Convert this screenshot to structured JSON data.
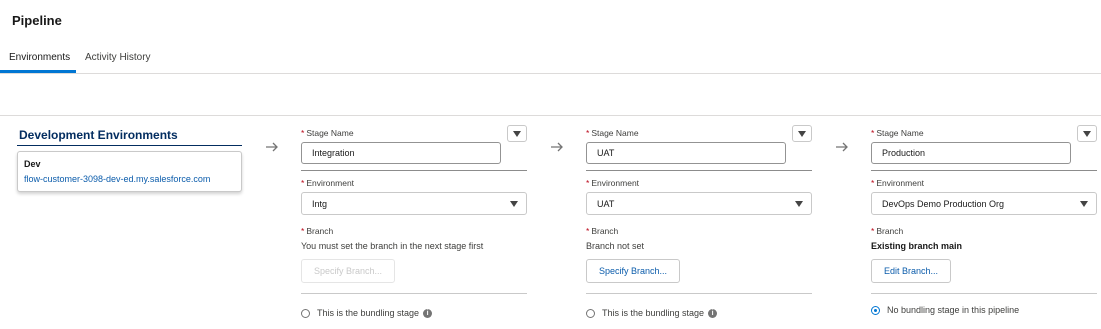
{
  "page": {
    "title": "Pipeline"
  },
  "tabs": [
    {
      "label": "Environments",
      "active": true
    },
    {
      "label": "Activity History",
      "active": false
    }
  ],
  "dev_column": {
    "title": "Development Environments",
    "card": {
      "name": "Dev",
      "url": "flow-customer-3098-dev-ed.my.salesforce.com"
    }
  },
  "icons": {
    "arrow": "arrow-right-icon",
    "menu": "chevron-down-icon",
    "select": "caret-down-icon",
    "info": "info-icon"
  },
  "colors": {
    "accent": "#0176d3",
    "link": "#0b5cab",
    "required": "#ba0517",
    "heading": "#032d60"
  },
  "stages": [
    {
      "stage_name_label": "Stage Name",
      "stage_name_value": "Integration",
      "environment_label": "Environment",
      "environment_value": "Intg",
      "branch_label": "Branch",
      "branch_status": "You must set the branch in the next stage first",
      "branch_button": "Specify Branch...",
      "branch_button_disabled": true,
      "radio_label": "This is the bundling stage",
      "radio_checked": false
    },
    {
      "stage_name_label": "Stage Name",
      "stage_name_value": "UAT",
      "environment_label": "Environment",
      "environment_value": "UAT",
      "branch_label": "Branch",
      "branch_status": "Branch not set",
      "branch_button": "Specify Branch...",
      "branch_button_disabled": false,
      "radio_label": "This is the bundling stage",
      "radio_checked": false
    },
    {
      "stage_name_label": "Stage Name",
      "stage_name_value": "Production",
      "environment_label": "Environment",
      "environment_value": "DevOps Demo Production Org",
      "branch_label": "Branch",
      "branch_status": "Existing branch main",
      "branch_button": "Edit Branch...",
      "branch_button_disabled": false,
      "radio_label": "No bundling stage in this pipeline",
      "radio_checked": true
    }
  ]
}
